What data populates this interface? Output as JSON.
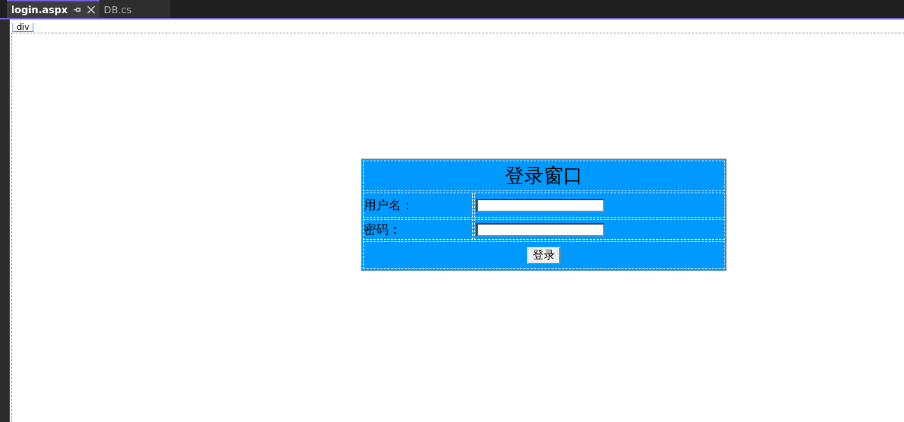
{
  "tabs": [
    {
      "label": "login.aspx",
      "selected": true,
      "pinned": true
    },
    {
      "label": "DB.cs",
      "selected": false,
      "pinned": false
    }
  ],
  "element_tag": "div",
  "form": {
    "title": "登录窗口",
    "fields": [
      {
        "label": "用户名："
      },
      {
        "label": "密码："
      }
    ],
    "button": "登录"
  }
}
